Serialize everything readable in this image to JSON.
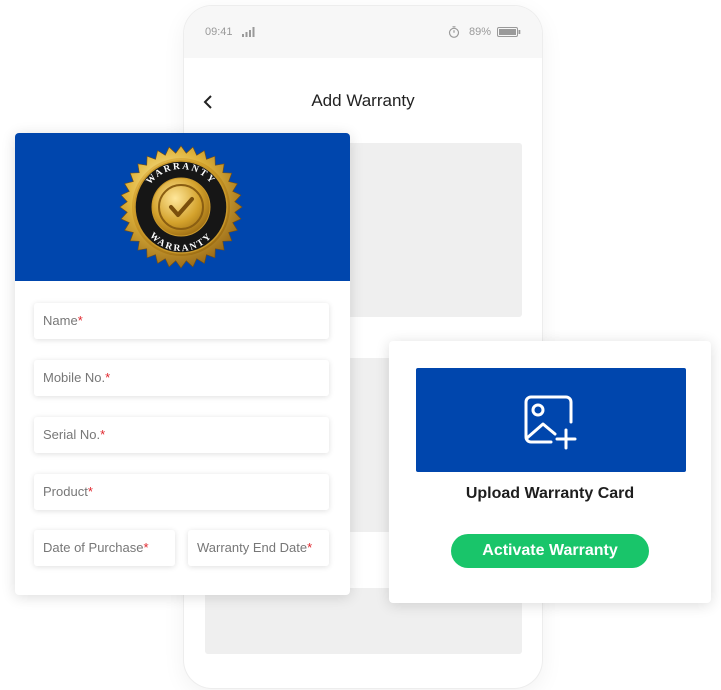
{
  "status_bar": {
    "time": "09:41",
    "battery": "89%"
  },
  "nav": {
    "title": "Add Warranty"
  },
  "seal": {
    "text_top": "WARRANTY",
    "text_bottom": "WARRANTY"
  },
  "form": {
    "required_mark": "*",
    "fields": [
      {
        "label": "Name",
        "required": true
      },
      {
        "label": "Mobile No.",
        "required": true
      },
      {
        "label": "Serial No.",
        "required": true
      },
      {
        "label": "Product",
        "required": true
      },
      {
        "label": "Date of Purchase",
        "required": true
      },
      {
        "label": "Warranty End Date",
        "required": true
      }
    ]
  },
  "upload": {
    "title": "Upload Warranty Card",
    "activate_label": "Activate Warranty"
  },
  "colors": {
    "brand_blue": "#0046ad",
    "accent_green": "#19c56a",
    "required_red": "#e0262d",
    "seal_gold": "#d4a22c"
  }
}
